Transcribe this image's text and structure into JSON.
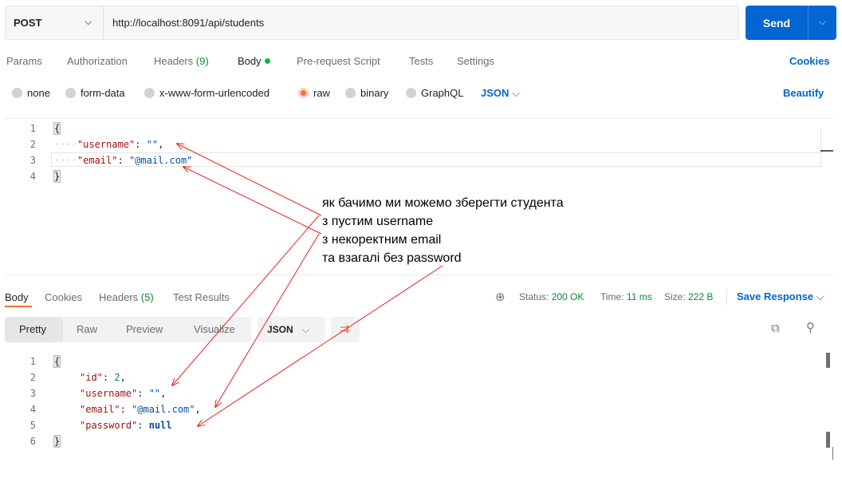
{
  "request": {
    "method": "POST",
    "url": "http://localhost:8091/api/students",
    "send_label": "Send"
  },
  "request_tabs": {
    "params": "Params",
    "authorization": "Authorization",
    "headers": "Headers",
    "headers_count": "(9)",
    "body": "Body",
    "prerequest": "Pre-request Script",
    "tests": "Tests",
    "settings": "Settings",
    "cookies": "Cookies"
  },
  "body_types": {
    "none": "none",
    "form_data": "form-data",
    "urlencoded": "x-www-form-urlencoded",
    "raw": "raw",
    "binary": "binary",
    "graphql": "GraphQL",
    "json": "JSON",
    "beautify": "Beautify",
    "selected": "raw"
  },
  "request_body": {
    "line_numbers": [
      "1",
      "2",
      "3",
      "4"
    ],
    "open_brace": "{",
    "close_brace": "}",
    "username_key": "\"username\"",
    "username_val": "\"\"",
    "email_key": "\"email\"",
    "email_val": "\"@mail.com\""
  },
  "response_tabs": {
    "body": "Body",
    "cookies": "Cookies",
    "headers": "Headers",
    "headers_count": "(5)",
    "test_results": "Test Results",
    "status_label": "Status:",
    "status_value": "200 OK",
    "time_label": "Time:",
    "time_value": "11 ms",
    "size_label": "Size:",
    "size_value": "222 B",
    "save_response": "Save Response"
  },
  "view_modes": {
    "pretty": "Pretty",
    "raw": "Raw",
    "preview": "Preview",
    "visualize": "Visualize",
    "format": "JSON"
  },
  "response_body": {
    "line_numbers": [
      "1",
      "2",
      "3",
      "4",
      "5",
      "6"
    ],
    "open_brace": "{",
    "close_brace": "}",
    "id_key": "\"id\"",
    "id_val": "2",
    "username_key": "\"username\"",
    "username_val": "\"\"",
    "email_key": "\"email\"",
    "email_val": "\"@mail.com\"",
    "password_key": "\"password\"",
    "password_val": "null"
  },
  "annotation": {
    "line1": "як бачимо ми можемо зберегти студента",
    "line2": "з пустим username",
    "line3": "з некоректним email",
    "line4": "та взагалі без password"
  },
  "colors": {
    "accent_orange": "#ff6c37",
    "primary_blue": "#0265d2",
    "status_green": "#0c8a31",
    "annotation_red": "#e8231c"
  }
}
